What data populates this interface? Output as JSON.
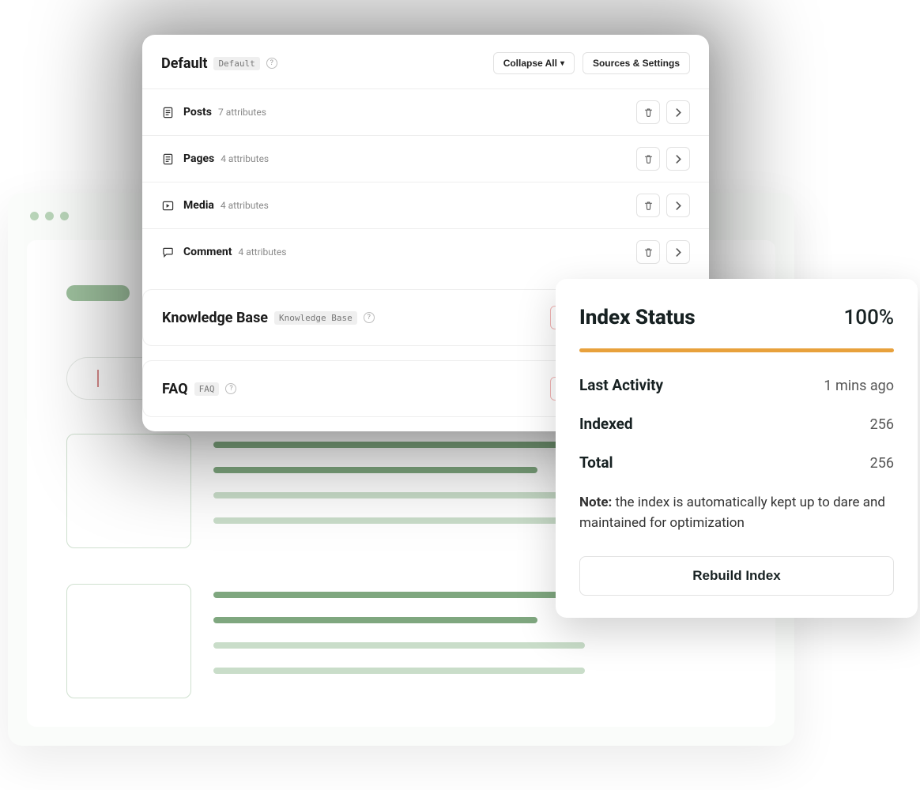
{
  "groups": {
    "default_title": "Default",
    "default_badge": "Default",
    "kb_title": "Knowledge Base",
    "kb_badge": "Knowledge Base",
    "faq_title": "FAQ",
    "faq_badge": "FAQ",
    "collapse_label": "Collapse All",
    "sources_label": "Sources & Settings",
    "items": [
      {
        "name": "Posts",
        "attrs": "7 attributes"
      },
      {
        "name": "Pages",
        "attrs": "4 attributes"
      },
      {
        "name": "Media",
        "attrs": "4 attributes"
      },
      {
        "name": "Comment",
        "attrs": "4 attributes"
      }
    ]
  },
  "status": {
    "title": "Index Status",
    "pct": "100%",
    "last_activity_label": "Last Activity",
    "last_activity_val": "1 mins ago",
    "indexed_label": "Indexed",
    "indexed_val": "256",
    "total_label": "Total",
    "total_val": "256",
    "note_bold": "Note:",
    "note_text": " the index is automatically kept up to dare and maintained for optimization",
    "rebuild_label": "Rebuild Index"
  }
}
